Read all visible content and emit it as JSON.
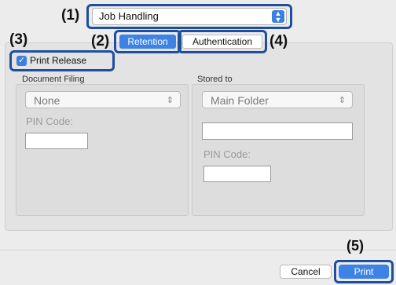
{
  "callouts": {
    "c1": "(1)",
    "c2": "(2)",
    "c3": "(3)",
    "c4": "(4)",
    "c5": "(5)"
  },
  "job_handling": {
    "value": "Job Handling",
    "arrows": "⌃⌄"
  },
  "tabs": {
    "retention": "Retention",
    "authentication": "Authentication"
  },
  "print_release": {
    "label": "Print Release",
    "checked": true
  },
  "document_filing": {
    "title": "Document Filing",
    "select_value": "None",
    "pin_label": "PIN Code:",
    "pin_value": ""
  },
  "stored_to": {
    "title": "Stored to",
    "select_value": "Main Folder",
    "folder_value": "",
    "pin_label": "PIN Code:",
    "pin_value": ""
  },
  "buttons": {
    "cancel": "Cancel",
    "print": "Print"
  },
  "colors": {
    "accent": "#3b7fe0",
    "callout_box": "#1f4e9c"
  }
}
